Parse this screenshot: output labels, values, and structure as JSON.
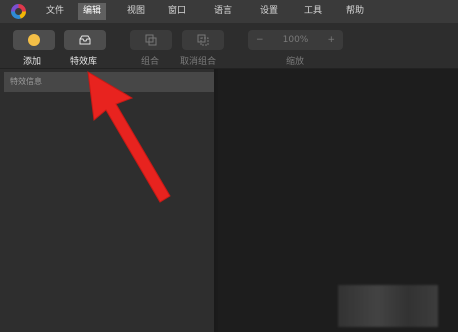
{
  "menubar": {
    "items": [
      "文件",
      "编辑",
      "视图",
      "窗口",
      "语言",
      "设置",
      "工具",
      "帮助"
    ],
    "active_index": 1
  },
  "toolbar": {
    "add_label": "添加",
    "effects_library_label": "特效库",
    "group_label": "组合",
    "ungroup_label": "取消组合",
    "zoom_minus": "−",
    "zoom_value": "100%",
    "zoom_plus": "+",
    "zoom_label": "缩放"
  },
  "left_panel": {
    "header": "特效信息"
  },
  "colors": {
    "add_dot": "#f4bf47",
    "active_menu": "#606060",
    "annotation_arrow": "#e8231f"
  },
  "icons": [
    "app-logo-icon",
    "inbox-icon",
    "group-icon",
    "ungroup-icon"
  ]
}
